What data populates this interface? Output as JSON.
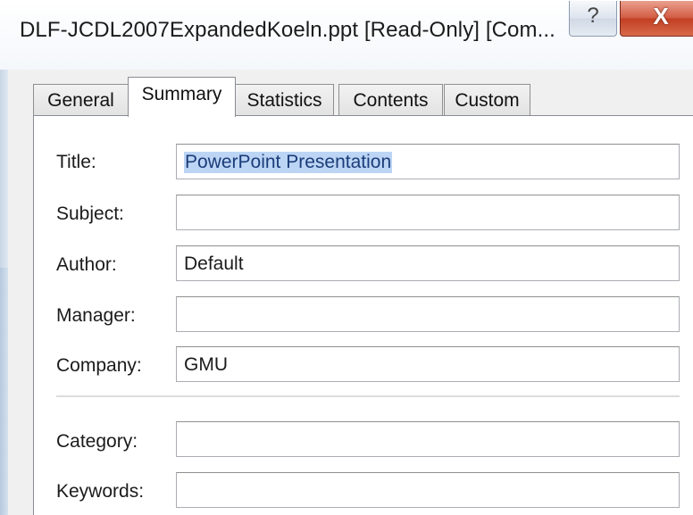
{
  "window": {
    "title": "DLF-JCDL2007ExpandedKoeln.ppt [Read-Only] [Com...",
    "help_glyph": "?",
    "close_glyph": "X"
  },
  "tabs": [
    {
      "label": "General",
      "active": false
    },
    {
      "label": "Summary",
      "active": true
    },
    {
      "label": "Statistics",
      "active": false
    },
    {
      "label": "Contents",
      "active": false
    },
    {
      "label": "Custom",
      "active": false
    }
  ],
  "summary": {
    "title": {
      "label": "Title:",
      "value": "PowerPoint Presentation",
      "selected": true
    },
    "subject": {
      "label": "Subject:",
      "value": ""
    },
    "author": {
      "label": "Author:",
      "value": "Default"
    },
    "manager": {
      "label": "Manager:",
      "value": ""
    },
    "company": {
      "label": "Company:",
      "value": "GMU"
    },
    "category": {
      "label": "Category:",
      "value": ""
    },
    "keywords": {
      "label": "Keywords:",
      "value": ""
    }
  },
  "colors": {
    "close_button": "#c8452a",
    "selection_highlight": "#bcd5f5"
  }
}
